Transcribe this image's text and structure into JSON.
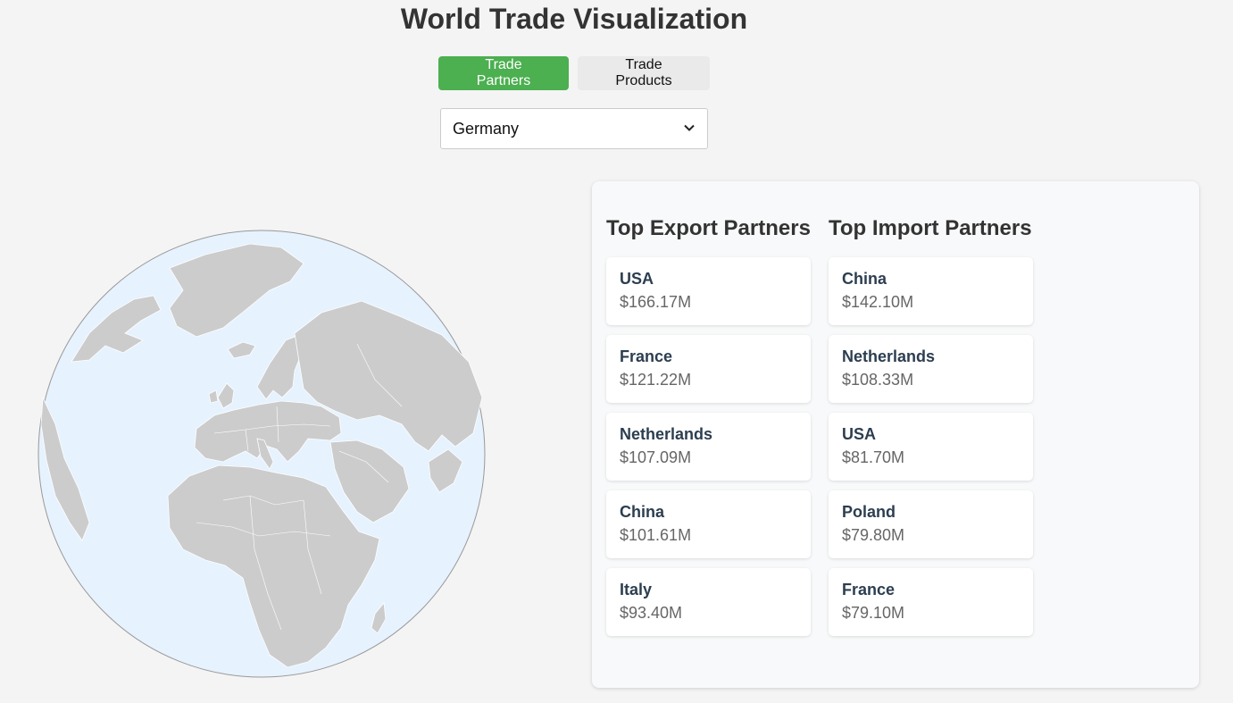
{
  "page": {
    "title": "World Trade Visualization"
  },
  "tabs": [
    {
      "label": "Trade Partners",
      "active": true
    },
    {
      "label": "Trade Products",
      "active": false
    }
  ],
  "country_select": {
    "value": "Germany"
  },
  "colors": {
    "accent": "#4caf50",
    "ocean": "#e6f2fd",
    "land": "#cccccc"
  },
  "panel": {
    "exports": {
      "heading": "Top Export Partners",
      "items": [
        {
          "name": "USA",
          "value": "$166.17M"
        },
        {
          "name": "France",
          "value": "$121.22M"
        },
        {
          "name": "Netherlands",
          "value": "$107.09M"
        },
        {
          "name": "China",
          "value": "$101.61M"
        },
        {
          "name": "Italy",
          "value": "$93.40M"
        }
      ]
    },
    "imports": {
      "heading": "Top Import Partners",
      "items": [
        {
          "name": "China",
          "value": "$142.10M"
        },
        {
          "name": "Netherlands",
          "value": "$108.33M"
        },
        {
          "name": "USA",
          "value": "$81.70M"
        },
        {
          "name": "Poland",
          "value": "$79.80M"
        },
        {
          "name": "France",
          "value": "$79.10M"
        }
      ]
    }
  }
}
